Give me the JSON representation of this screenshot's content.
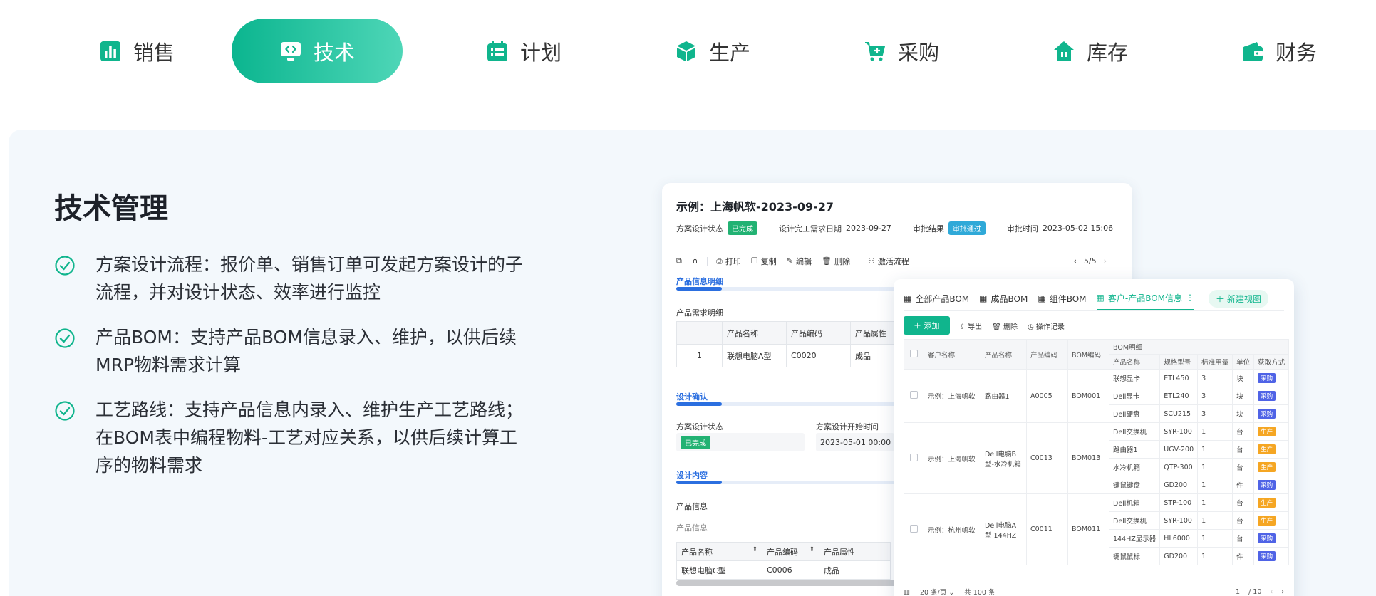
{
  "tabs": [
    {
      "label": "销售",
      "icon": "bar-chart-icon",
      "active": false
    },
    {
      "label": "技术",
      "icon": "code-monitor-icon",
      "active": true
    },
    {
      "label": "计划",
      "icon": "calendar-list-icon",
      "active": false
    },
    {
      "label": "生产",
      "icon": "cube-icon",
      "active": false
    },
    {
      "label": "采购",
      "icon": "cart-icon",
      "active": false
    },
    {
      "label": "库存",
      "icon": "warehouse-icon",
      "active": false
    },
    {
      "label": "财务",
      "icon": "wallet-icon",
      "active": false
    }
  ],
  "colors": {
    "accent": "#10b58d",
    "panel_bg": "#f3f8fc",
    "blue": "#2b6fe0"
  },
  "panel": {
    "title": "技术管理",
    "features": [
      "方案设计流程：报价单、销售订单可发起方案设计的子流程，并对设计状态、效率进行监控",
      "产品BOM：支持产品BOM信息录入、维护，以供后续MRP物料需求计算",
      "工艺路线：支持产品信息内录入、维护生产工艺路线；在BOM表中编程物料-工艺对应关系，以供后续计算工序的物料需求"
    ]
  },
  "cardA": {
    "title": "示例：上海帆软-2023-09-27",
    "meta": {
      "design_status_label": "方案设计状态",
      "design_status_value": "已完成",
      "due_label": "设计完工需求日期",
      "due_value": "2023-09-27",
      "approval_label": "审批结果",
      "approval_value": "审批通过",
      "approval_time_label": "审批时间",
      "approval_time_value": "2023-05-02 15:06"
    },
    "toolbar": {
      "print": "打印",
      "copy": "复制",
      "edit": "编辑",
      "delete": "删除",
      "activate": "激活流程",
      "pager": "5/5"
    },
    "sec_product_info": "产品信息明细",
    "demand_label": "产品需求明细",
    "demand_table": {
      "headers": [
        "",
        "产品名称",
        "产品编码",
        "产品属性"
      ],
      "rows": [
        [
          "1",
          "联想电脑A型",
          "C0020",
          "成品"
        ]
      ]
    },
    "sec_confirm": "设计确认",
    "confirm": {
      "status_label": "方案设计状态",
      "status_value": "已完成",
      "start_label": "方案设计开始时间",
      "start_value": "2023-05-01 00:00"
    },
    "sec_content": "设计内容",
    "product_info_label": "产品信息",
    "product_info_sub": "产品信息",
    "content_table": {
      "headers": [
        "产品名称",
        "产品编码",
        "产品属性"
      ],
      "rows": [
        [
          "联想电脑C型",
          "C0006",
          "成品"
        ]
      ]
    }
  },
  "cardB": {
    "views": [
      "全部产品BOM",
      "成品BOM",
      "组件BOM",
      "客户-产品BOM信息"
    ],
    "new_view": "新建视图",
    "toolbar": {
      "add": "添加",
      "export": "导出",
      "delete": "删除",
      "log": "操作记录"
    },
    "grid_headers": {
      "customer": "客户名称",
      "product": "产品名称",
      "code": "产品编码",
      "bom": "BOM编码",
      "bom_detail": "BOM明细",
      "sub_product": "产品名称",
      "spec": "规格型号",
      "qty": "标准用量",
      "unit": "单位",
      "method": "获取方式"
    },
    "groups": [
      {
        "customer": "示例：上海帆软",
        "product": "路由器1",
        "code": "A0005",
        "bom": "BOM001",
        "items": [
          {
            "name": "联想显卡",
            "spec": "ETL450",
            "qty": "3",
            "unit": "块",
            "method": "采购"
          },
          {
            "name": "Dell显卡",
            "spec": "ETL240",
            "qty": "3",
            "unit": "块",
            "method": "采购"
          },
          {
            "name": "Dell硬盘",
            "spec": "SCU215",
            "qty": "3",
            "unit": "块",
            "method": "采购"
          }
        ]
      },
      {
        "customer": "示例：上海帆软",
        "product": "Dell电脑B型-水冷机箱",
        "code": "C0013",
        "bom": "BOM013",
        "items": [
          {
            "name": "Dell交换机",
            "spec": "SYR-100",
            "qty": "1",
            "unit": "台",
            "method": "生产"
          },
          {
            "name": "路由器1",
            "spec": "UGV-200",
            "qty": "1",
            "unit": "台",
            "method": "生产"
          },
          {
            "name": "水冷机箱",
            "spec": "QTP-300",
            "qty": "1",
            "unit": "台",
            "method": "生产"
          },
          {
            "name": "键鼠键盘",
            "spec": "GD200",
            "qty": "1",
            "unit": "件",
            "method": "采购"
          }
        ]
      },
      {
        "customer": "示例：杭州帆软",
        "product": "Dell电脑A型 144HZ",
        "code": "C0011",
        "bom": "BOM011",
        "items": [
          {
            "name": "Dell机箱",
            "spec": "STP-100",
            "qty": "1",
            "unit": "台",
            "method": "生产"
          },
          {
            "name": "Dell交换机",
            "spec": "SYR-100",
            "qty": "1",
            "unit": "台",
            "method": "生产"
          },
          {
            "name": "144HZ显示器",
            "spec": "HL6000",
            "qty": "1",
            "unit": "台",
            "method": "采购"
          },
          {
            "name": "键鼠鼠标",
            "spec": "GD200",
            "qty": "1",
            "unit": "件",
            "method": "采购"
          }
        ]
      }
    ],
    "footer": {
      "page_size": "20 条/页",
      "total": "共 100 条",
      "page": "1",
      "pages": "/ 10"
    }
  }
}
